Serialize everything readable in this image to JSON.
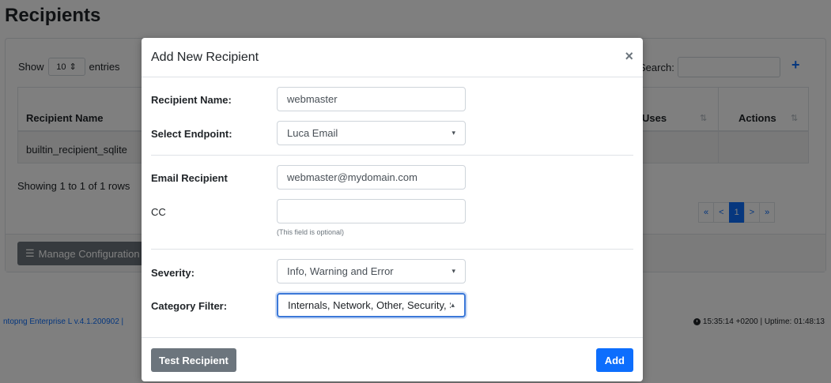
{
  "page": {
    "title": "Recipients",
    "show_label": "Show",
    "entries_value": "10",
    "entries_label": "entries",
    "search_label": "Search:",
    "table": {
      "col_name": "Recipient Name",
      "col_uses": "Uses",
      "col_actions": "Actions",
      "rows": [
        {
          "name": "builtin_recipient_sqlite"
        }
      ]
    },
    "showing": "Showing 1 to 1 of 1 rows",
    "pager": [
      "«",
      "<",
      "1",
      ">",
      "»"
    ],
    "pager_active": "1",
    "manage_label": "Manage Configuration",
    "footer_left": "ntopng Enterprise L v.4.1.200902 |",
    "footer_right": "15:35:14 +0200 | Uptime: 01:48:13"
  },
  "modal": {
    "title": "Add New Recipient",
    "close": "×",
    "recipient_name_label": "Recipient Name:",
    "recipient_name_value": "webmaster",
    "endpoint_label": "Select Endpoint:",
    "endpoint_value": "Luca Email",
    "email_label": "Email Recipient",
    "email_value": "webmaster@mydomain.com",
    "cc_label": "CC",
    "cc_value": "",
    "cc_hint": "(This field is optional)",
    "severity_label": "Severity:",
    "severity_value": "Info, Warning and Error",
    "category_label": "Category Filter:",
    "category_value": "Internals, Network, Other, Security, S",
    "test_button": "Test Recipient",
    "add_button": "Add"
  },
  "colors": {
    "primary": "#0d6efd",
    "secondary": "#6c757d"
  }
}
